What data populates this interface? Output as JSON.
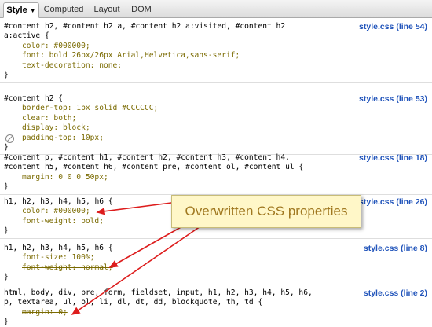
{
  "tabs": [
    {
      "label": "Style",
      "active": true,
      "icon": "chevron-down-icon"
    },
    {
      "label": "Computed",
      "active": false
    },
    {
      "label": "Layout",
      "active": false
    },
    {
      "label": "DOM",
      "active": false
    }
  ],
  "rules": [
    {
      "selector_lines": [
        "#content h2, #content h2 a, #content h2 a:visited, #content h2",
        "a:active {"
      ],
      "source": "style.css (line 54)",
      "props": [
        {
          "text": "color: #000000;",
          "overwritten": false
        },
        {
          "text": "font: bold 26px/26px Arial,Helvetica,sans-serif;",
          "overwritten": false
        },
        {
          "text": "text-decoration: none;",
          "overwritten": false
        }
      ]
    },
    {
      "selector_lines": [
        "#content h2 {"
      ],
      "source": "style.css (line 53)",
      "props": [
        {
          "text": "border-top: 1px solid #CCCCCC;",
          "overwritten": false
        },
        {
          "text": "clear: both;",
          "overwritten": false
        },
        {
          "text": "display: block;",
          "overwritten": false
        },
        {
          "text": "padding-top: 10px;",
          "overwritten": false,
          "disabled": true
        }
      ]
    },
    {
      "selector_lines": [
        "#content p, #content h1, #content h2, #content h3, #content h4,",
        "#content h5, #content h6, #content pre, #content ol, #content ul {"
      ],
      "source": "style.css (line 18)",
      "props": [
        {
          "text": "margin: 0 0 0 50px;",
          "overwritten": false
        }
      ]
    },
    {
      "selector_lines": [
        "h1, h2, h3, h4, h5, h6 {"
      ],
      "source": "style.css (line 26)",
      "props": [
        {
          "text": "color: #000000;",
          "overwritten": true
        },
        {
          "text": "font-weight: bold;",
          "overwritten": false
        }
      ]
    },
    {
      "selector_lines": [
        "h1, h2, h3, h4, h5, h6 {"
      ],
      "source": "style.css (line 8)",
      "props": [
        {
          "text": "font-size: 100%;",
          "overwritten": false
        },
        {
          "text": "font-weight: normal;",
          "overwritten": true
        }
      ]
    },
    {
      "selector_lines": [
        "html, body, div, pre, form, fieldset, input, h1, h2, h3, h4, h5, h6,",
        "p, textarea, ul, ol, li, dl, dt, dd, blockquote, th, td {"
      ],
      "source": "style.css (line 2)",
      "props": [
        {
          "text": "margin: 0;",
          "overwritten": true
        }
      ]
    }
  ],
  "close_brace": "}",
  "annotation": {
    "text": "Overwritten CSS properties"
  },
  "colors": {
    "link": "#2255bb",
    "property": "#7a6a00",
    "arrow": "#dd1c1c",
    "callout_bg": "#fff7c8",
    "callout_text": "#a07820"
  }
}
